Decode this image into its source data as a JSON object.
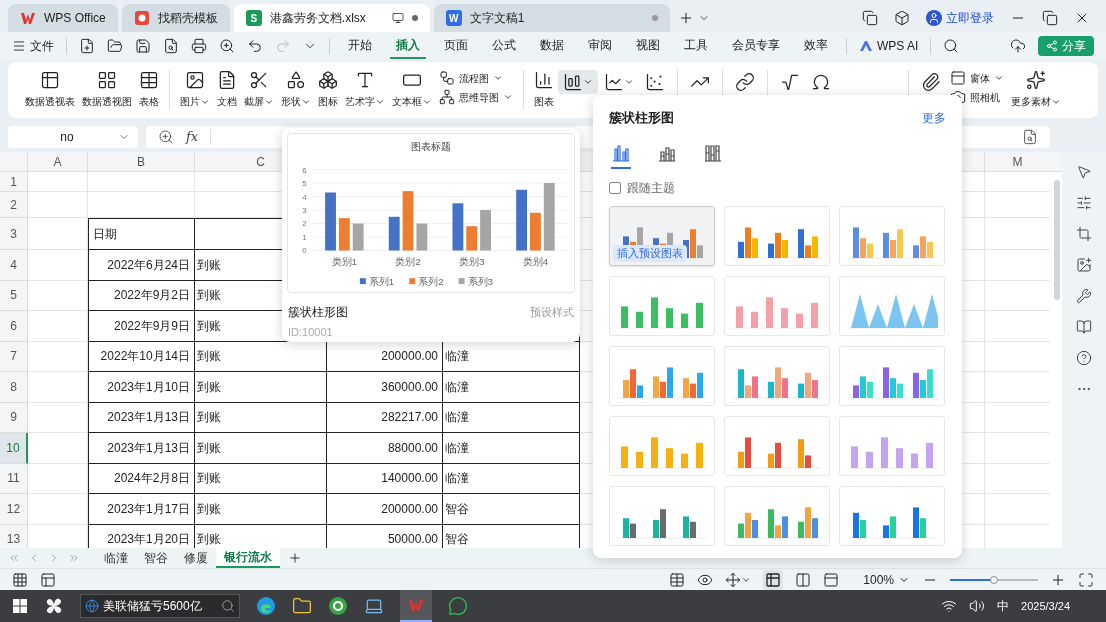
{
  "title_tabs": [
    {
      "label": "WPS Office",
      "kind": "wps",
      "selected": false
    },
    {
      "label": "找稻壳模板",
      "kind": "template",
      "selected": false
    },
    {
      "label": "港鑫劳务文档.xlsx",
      "kind": "sheet",
      "badge": "S",
      "selected": true
    },
    {
      "label": "文字文稿1",
      "kind": "doc",
      "badge": "W",
      "selected": false
    }
  ],
  "login": "立即登录",
  "menu": {
    "file": "文件",
    "items": [
      {
        "label": "开始",
        "selected": false
      },
      {
        "label": "插入",
        "selected": true
      },
      {
        "label": "页面",
        "selected": false
      },
      {
        "label": "公式",
        "selected": false
      },
      {
        "label": "数据",
        "selected": false
      },
      {
        "label": "审阅",
        "selected": false
      },
      {
        "label": "视图",
        "selected": false
      },
      {
        "label": "工具",
        "selected": false
      },
      {
        "label": "会员专享",
        "selected": false
      },
      {
        "label": "效率",
        "selected": false
      }
    ],
    "ai": "WPS AI",
    "share": "分享"
  },
  "ribbon": [
    {
      "kind": "big",
      "label": "数据透视表",
      "dropdown": false,
      "selected": false
    },
    {
      "kind": "big",
      "label": "数据透视图",
      "dropdown": false,
      "selected": false
    },
    {
      "kind": "big",
      "label": "表格",
      "dropdown": false,
      "selected": false
    },
    {
      "kind": "separator"
    },
    {
      "kind": "big",
      "label": "图片",
      "dropdown": true,
      "selected": false
    },
    {
      "kind": "big",
      "label": "文档",
      "dropdown": false,
      "selected": false
    },
    {
      "kind": "big",
      "label": "截屏",
      "dropdown": true,
      "selected": false
    },
    {
      "kind": "big",
      "label": "形状",
      "dropdown": true,
      "selected": false
    },
    {
      "kind": "big",
      "label": "图标",
      "dropdown": false,
      "selected": false
    },
    {
      "kind": "big",
      "label": "艺术字",
      "dropdown": true,
      "selected": false
    },
    {
      "kind": "big",
      "label": "文本框",
      "dropdown": true,
      "selected": false
    },
    {
      "kind": "stack",
      "items": [
        {
          "label": "流程图",
          "dropdown": true
        },
        {
          "label": "思维导图",
          "dropdown": true
        }
      ]
    },
    {
      "kind": "separator"
    },
    {
      "kind": "big",
      "label": "图表",
      "dropdown": false,
      "selected": false
    },
    {
      "kind": "small",
      "dropdown": true,
      "selected": true
    },
    {
      "kind": "small",
      "dropdown": true,
      "selected": false
    },
    {
      "kind": "small",
      "dropdown": false,
      "selected": false
    },
    {
      "kind": "separator"
    },
    {
      "kind": "small",
      "dropdown": false,
      "selected": false
    },
    {
      "kind": "separator"
    },
    {
      "kind": "small",
      "dropdown": false,
      "selected": false
    },
    {
      "kind": "separator"
    },
    {
      "kind": "small",
      "dropdown": false,
      "selected": false
    },
    {
      "kind": "small",
      "dropdown": false,
      "selected": false
    },
    {
      "kind": "separator"
    },
    {
      "kind": "small",
      "dropdown": false,
      "selected": false
    },
    {
      "kind": "stack",
      "items": [
        {
          "label": "窗体",
          "dropdown": true
        },
        {
          "label": "照相机",
          "dropdown": false
        }
      ]
    },
    {
      "kind": "big",
      "label": "更多素材",
      "dropdown": true,
      "selected": false
    }
  ],
  "name_box": "no",
  "fx": "fx",
  "columns": [
    "A",
    "B",
    "C",
    "M"
  ],
  "rows": [
    {
      "number": "1",
      "kind": "blank",
      "selected": false
    },
    {
      "number": "2",
      "kind": "blank",
      "selected": false
    },
    {
      "number": "3",
      "kind": "header",
      "selected": false,
      "date": "日期"
    },
    {
      "number": "4",
      "kind": "data",
      "selected": false,
      "date": "2022年6月24日",
      "status": "到账"
    },
    {
      "number": "5",
      "kind": "data",
      "selected": false,
      "date": "2022年9月2日",
      "status": "到账"
    },
    {
      "number": "6",
      "kind": "data",
      "selected": false,
      "date": "2022年9月9日",
      "status": "到账"
    },
    {
      "number": "7",
      "kind": "data",
      "selected": false,
      "date": "2022年10月14日",
      "status": "到账",
      "amount": "200000.00",
      "place": "临潼"
    },
    {
      "number": "8",
      "kind": "data",
      "selected": false,
      "date": "2023年1月10日",
      "status": "到账",
      "amount": "360000.00",
      "place": "临潼"
    },
    {
      "number": "9",
      "kind": "data",
      "selected": false,
      "date": "2023年1月13日",
      "status": "到账",
      "amount": "282217.00",
      "place": "临潼"
    },
    {
      "number": "10",
      "kind": "data",
      "selected": true,
      "date": "2023年1月13日",
      "status": "到账",
      "amount": "88000.00",
      "place": "临潼"
    },
    {
      "number": "11",
      "kind": "data",
      "selected": false,
      "date": "2024年2月8日",
      "status": "到账",
      "amount": "140000.00",
      "place": "临潼"
    },
    {
      "number": "12",
      "kind": "data",
      "selected": false,
      "date": "2023年1月17日",
      "status": "到账",
      "amount": "200000.00",
      "place": "智谷"
    },
    {
      "number": "13",
      "kind": "data",
      "selected": false,
      "date": "2023年1月20日",
      "status": "到账",
      "amount": "50000.00",
      "place": "智谷"
    }
  ],
  "sheet_tabs": [
    {
      "label": "临潼",
      "selected": false
    },
    {
      "label": "智谷",
      "selected": false
    },
    {
      "label": "修厦",
      "selected": false
    },
    {
      "label": "银行流水",
      "selected": true
    }
  ],
  "zoom": {
    "reading": "100%",
    "level": 0.5
  },
  "taskbar": {
    "search": "美联储猛亏5600亿",
    "ime": "中",
    "date": "2025/3/24"
  },
  "preview": {
    "name": "簇状柱形图",
    "id": "ID:10001",
    "tag": "预设样式",
    "chart_data": {
      "type": "bar",
      "title": "图表标题",
      "categories": [
        "类别1",
        "类别2",
        "类别3",
        "类别4"
      ],
      "series": [
        {
          "name": "系列1",
          "color": "#4472c4",
          "values": [
            4.3,
            2.5,
            3.5,
            4.5
          ]
        },
        {
          "name": "系列2",
          "color": "#ed7d31",
          "values": [
            2.4,
            4.4,
            1.8,
            2.8
          ]
        },
        {
          "name": "系列3",
          "color": "#a5a5a5",
          "values": [
            2,
            2,
            3,
            5
          ]
        }
      ],
      "ylim": [
        0,
        6
      ],
      "yticks": [
        0,
        1,
        2,
        3,
        4,
        5,
        6
      ],
      "grid": true,
      "legend": "bottom"
    }
  },
  "panel": {
    "title": "簇状柱形图",
    "more": "更多",
    "subtypes": [
      {
        "kind": "clustered",
        "selected": true
      },
      {
        "kind": "stacked",
        "selected": false
      },
      {
        "kind": "percent",
        "selected": false
      }
    ],
    "follow_theme": {
      "label": "跟随主题",
      "checked": false
    },
    "hover_label": "插入预设图表",
    "thumbnails": [
      {
        "selected": true
      },
      {
        "selected": false
      },
      {
        "selected": false
      },
      {
        "selected": false
      },
      {
        "selected": false
      },
      {
        "selected": false
      },
      {
        "selected": false
      },
      {
        "selected": false
      },
      {
        "selected": false
      },
      {
        "selected": false
      },
      {
        "selected": false
      },
      {
        "selected": false
      },
      {
        "selected": false
      },
      {
        "selected": false
      },
      {
        "selected": false
      }
    ]
  }
}
